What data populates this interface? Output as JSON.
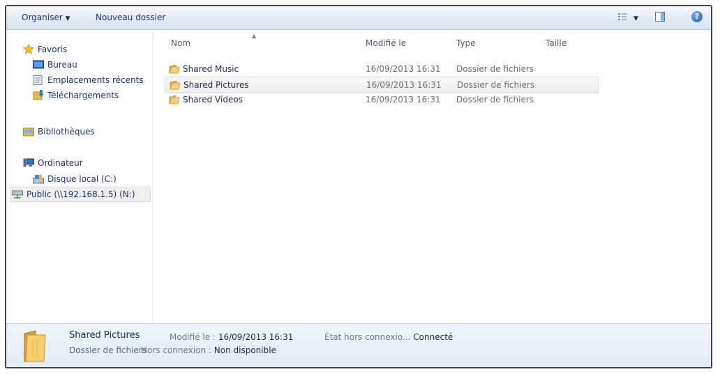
{
  "toolbar": {
    "organize_label": "Organiser",
    "new_folder_label": "Nouveau dossier"
  },
  "nav": {
    "favorites": "Favoris",
    "desktop": "Bureau",
    "recent": "Emplacements récents",
    "downloads": "Téléchargements",
    "libraries": "Bibliothèques",
    "computer": "Ordinateur",
    "local_disk": "Disque local (C:)",
    "network_drive": "Public (\\\\192.168.1.5) (N:)"
  },
  "columns": {
    "name": "Nom",
    "modified": "Modifié le",
    "type": "Type",
    "size": "Taille"
  },
  "files": [
    {
      "name": "Shared Music",
      "modified": "16/09/2013 16:31",
      "type": "Dossier de fichiers"
    },
    {
      "name": "Shared Pictures",
      "modified": "16/09/2013 16:31",
      "type": "Dossier de fichiers"
    },
    {
      "name": "Shared Videos",
      "modified": "16/09/2013 16:31",
      "type": "Dossier de fichiers"
    }
  ],
  "details": {
    "name": "Shared Pictures",
    "type": "Dossier de fichiers",
    "modified_label": "Modifié le :",
    "modified_value": "16/09/2013 16:31",
    "offline_label": "Hors connexion :",
    "offline_value": "Non disponible",
    "state_label": "État hors connexio...",
    "state_value": "Connecté"
  },
  "colors": {
    "accent_text": "#1e3287",
    "folder": "#e8b84a"
  }
}
